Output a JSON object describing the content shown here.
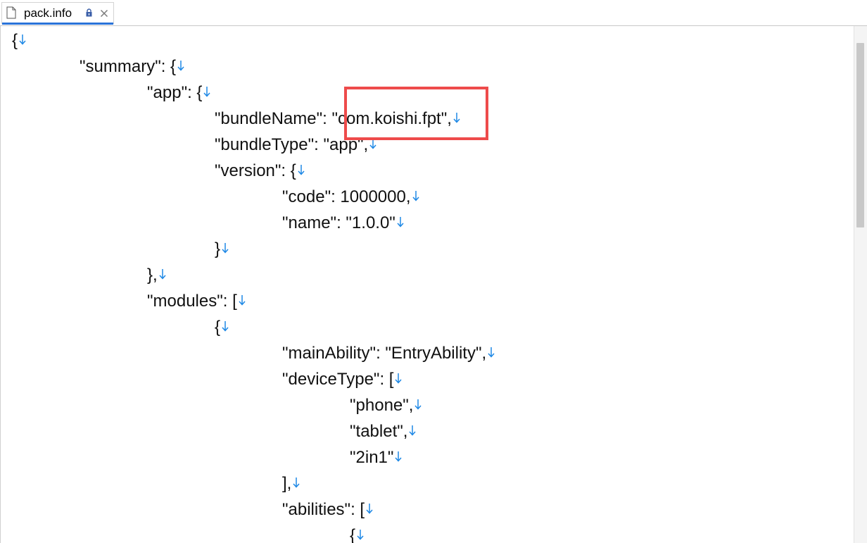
{
  "tab": {
    "title": "pack.info",
    "file_icon": "file-icon",
    "lock_icon": "lock-icon",
    "close_icon": "close-icon"
  },
  "editor": {
    "eol_icon": "line-break-arrow-icon",
    "eol_color": "#1e88e5",
    "highlight_color": "#ee4b4b",
    "lines": [
      {
        "indent": 0,
        "text": "{"
      },
      {
        "indent": 1,
        "text": "\"summary\": {"
      },
      {
        "indent": 2,
        "text": "\"app\": {"
      },
      {
        "indent": 3,
        "text": "\"bundleName\": \"com.koishi.fpt\","
      },
      {
        "indent": 3,
        "text": "\"bundleType\": \"app\","
      },
      {
        "indent": 3,
        "text": "\"version\": {"
      },
      {
        "indent": 4,
        "text": "\"code\": 1000000,"
      },
      {
        "indent": 4,
        "text": "\"name\": \"1.0.0\""
      },
      {
        "indent": 3,
        "text": "}"
      },
      {
        "indent": 2,
        "text": "},"
      },
      {
        "indent": 2,
        "text": "\"modules\": ["
      },
      {
        "indent": 3,
        "text": "{"
      },
      {
        "indent": 4,
        "text": "\"mainAbility\": \"EntryAbility\","
      },
      {
        "indent": 4,
        "text": "\"deviceType\": ["
      },
      {
        "indent": 5,
        "text": "\"phone\","
      },
      {
        "indent": 5,
        "text": "\"tablet\","
      },
      {
        "indent": 5,
        "text": "\"2in1\""
      },
      {
        "indent": 4,
        "text": "],"
      },
      {
        "indent": 4,
        "text": "\"abilities\": ["
      },
      {
        "indent": 5,
        "text": "{"
      }
    ]
  }
}
